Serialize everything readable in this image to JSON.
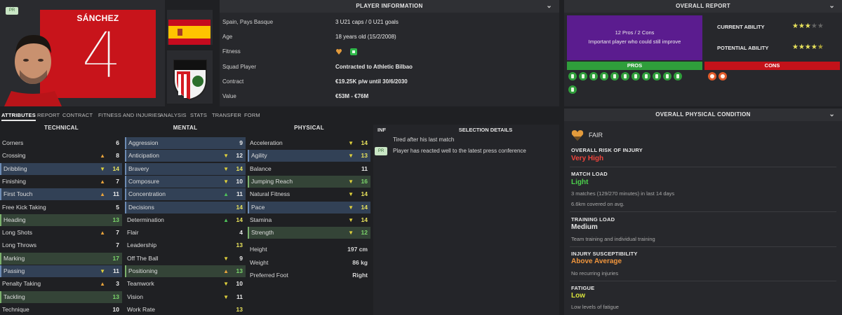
{
  "player": {
    "name": "SÁNCHEZ",
    "number": "4",
    "pr_badge": "PR"
  },
  "player_info": {
    "title": "PLAYER INFORMATION",
    "rows": [
      {
        "key": "Spain, Pays Basque",
        "value": "3 U21 caps / 0 U21 goals"
      },
      {
        "key": "Age",
        "value": "18 years old (15/2/2008)"
      },
      {
        "key": "Fitness",
        "value": ""
      },
      {
        "key": "Squad Player",
        "value": "Contracted to Athletic Bilbao"
      },
      {
        "key": "Contract",
        "value": "€19.25K p/w until 30/6/2030"
      },
      {
        "key": "Value",
        "value": "€53M - €76M"
      }
    ]
  },
  "overall_report": {
    "title": "OVERALL REPORT",
    "summary_line1": "12 Pros / 2 Cons",
    "summary_line2": "Important player who could still improve",
    "current_ability_label": "CURRENT ABILITY",
    "potential_ability_label": "POTENTIAL ABILITY",
    "current_stars": 3,
    "potential_stars": 4.5,
    "pros_label": "PROS",
    "cons_label": "CONS",
    "pros_count": 12,
    "cons_count": 2
  },
  "tabs": [
    "ATTRIBUTES",
    "REPORT",
    "CONTRACT",
    "FITNESS AND INJURIES",
    "ANALYSIS",
    "STATS",
    "TRANSFER",
    "FORM"
  ],
  "attributes": {
    "technical_title": "TECHNICAL",
    "mental_title": "MENTAL",
    "physical_title": "PHYSICAL",
    "technical": [
      {
        "name": "Corners",
        "value": "6",
        "arrow": "",
        "style": ""
      },
      {
        "name": "Crossing",
        "value": "8",
        "arrow": "up",
        "style": ""
      },
      {
        "name": "Dribbling",
        "value": "14",
        "arrow": "dn",
        "style": "hl"
      },
      {
        "name": "Finishing",
        "value": "7",
        "arrow": "up",
        "style": ""
      },
      {
        "name": "First Touch",
        "value": "11",
        "arrow": "up",
        "style": "hl"
      },
      {
        "name": "Free Kick Taking",
        "value": "5",
        "arrow": "",
        "style": ""
      },
      {
        "name": "Heading",
        "value": "13",
        "arrow": "",
        "style": "gr"
      },
      {
        "name": "Long Shots",
        "value": "7",
        "arrow": "up",
        "style": ""
      },
      {
        "name": "Long Throws",
        "value": "7",
        "arrow": "",
        "style": ""
      },
      {
        "name": "Marking",
        "value": "17",
        "arrow": "",
        "style": "gr"
      },
      {
        "name": "Passing",
        "value": "11",
        "arrow": "dn",
        "style": "hl"
      },
      {
        "name": "Penalty Taking",
        "value": "3",
        "arrow": "up",
        "style": ""
      },
      {
        "name": "Tackling",
        "value": "13",
        "arrow": "",
        "style": "gr"
      },
      {
        "name": "Technique",
        "value": "10",
        "arrow": "",
        "style": ""
      }
    ],
    "mental": [
      {
        "name": "Aggression",
        "value": "9",
        "arrow": "",
        "style": "hl"
      },
      {
        "name": "Anticipation",
        "value": "12",
        "arrow": "dn",
        "style": "hl"
      },
      {
        "name": "Bravery",
        "value": "14",
        "arrow": "dn",
        "style": "hl"
      },
      {
        "name": "Composure",
        "value": "10",
        "arrow": "dn",
        "style": "hl"
      },
      {
        "name": "Concentration",
        "value": "11",
        "arrow": "gup",
        "style": "hl"
      },
      {
        "name": "Decisions",
        "value": "14",
        "arrow": "",
        "style": "hl"
      },
      {
        "name": "Determination",
        "value": "14",
        "arrow": "gup",
        "style": ""
      },
      {
        "name": "Flair",
        "value": "4",
        "arrow": "",
        "style": ""
      },
      {
        "name": "Leadership",
        "value": "13",
        "arrow": "",
        "style": ""
      },
      {
        "name": "Off The Ball",
        "value": "9",
        "arrow": "dn",
        "style": ""
      },
      {
        "name": "Positioning",
        "value": "13",
        "arrow": "up",
        "style": "gr"
      },
      {
        "name": "Teamwork",
        "value": "10",
        "arrow": "dn",
        "style": ""
      },
      {
        "name": "Vision",
        "value": "11",
        "arrow": "dn",
        "style": ""
      },
      {
        "name": "Work Rate",
        "value": "13",
        "arrow": "",
        "style": ""
      }
    ],
    "physical": [
      {
        "name": "Acceleration",
        "value": "14",
        "arrow": "dn",
        "style": ""
      },
      {
        "name": "Agility",
        "value": "13",
        "arrow": "dn",
        "style": "hl"
      },
      {
        "name": "Balance",
        "value": "11",
        "arrow": "",
        "style": ""
      },
      {
        "name": "Jumping Reach",
        "value": "16",
        "arrow": "dn",
        "style": "gr"
      },
      {
        "name": "Natural Fitness",
        "value": "14",
        "arrow": "dn",
        "style": ""
      },
      {
        "name": "Pace",
        "value": "14",
        "arrow": "dn",
        "style": "hl"
      },
      {
        "name": "Stamina",
        "value": "14",
        "arrow": "dn",
        "style": ""
      },
      {
        "name": "Strength",
        "value": "12",
        "arrow": "dn",
        "style": "gr"
      }
    ],
    "body": [
      {
        "name": "Height",
        "value": "197 cm"
      },
      {
        "name": "Weight",
        "value": "86 kg"
      },
      {
        "name": "Preferred Foot",
        "value": "Right"
      }
    ]
  },
  "selection": {
    "inf_label": "INF",
    "title": "SELECTION DETAILS",
    "items": [
      {
        "badge": "",
        "text": "Tired after his last match"
      },
      {
        "badge": "PR",
        "text": "Player has reacted well to the latest press conference"
      }
    ]
  },
  "physical_condition": {
    "title": "OVERALL PHYSICAL CONDITION",
    "status": "FAIR",
    "risk_label": "OVERALL RISK OF INJURY",
    "risk_value": "Very High",
    "match_load_label": "MATCH LOAD",
    "match_load_value": "Light",
    "match_load_sub1": "3 matches (129/270 minutes) in last 14 days",
    "match_load_sub2": "6.6km covered on avg.",
    "training_load_label": "TRAINING LOAD",
    "training_load_value": "Medium",
    "training_load_sub": "Team training and individual training",
    "susceptibility_label": "INJURY SUSCEPTIBILITY",
    "susceptibility_value": "Above Average",
    "susceptibility_sub": "No recurring injuries",
    "fatigue_label": "FATIGUE",
    "fatigue_value": "Low",
    "fatigue_sub": "Low levels of fatigue",
    "colors": {
      "very_high": "#f0443c",
      "light": "#4cd14c",
      "medium": "#e6e6e6",
      "above_average": "#f0953c",
      "low": "#d8e23c"
    }
  }
}
